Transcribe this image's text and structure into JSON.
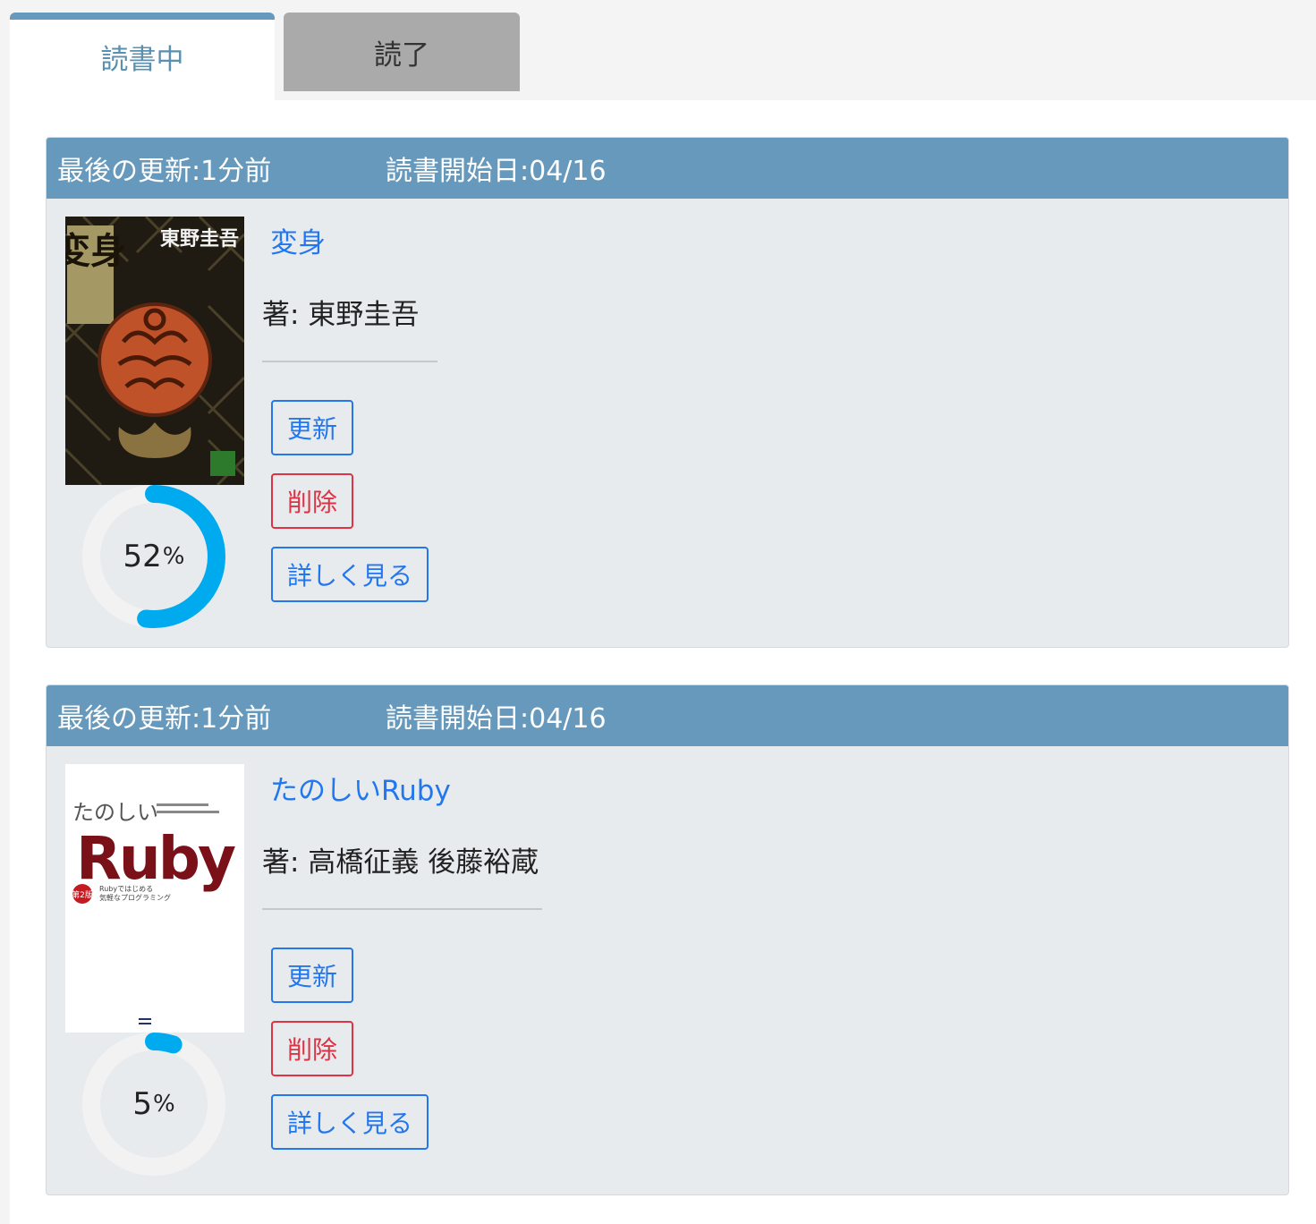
{
  "tabs": {
    "reading_label": "読書中",
    "finished_label": "読了"
  },
  "books": [
    {
      "updated": "最後の更新:1分前",
      "started": "読書開始日:04/16",
      "title": "変身",
      "author": "著: 東野圭吾",
      "progress": 52,
      "progress_label": "52",
      "percent_sign": "%",
      "cover_text": {
        "title": "変身",
        "author": "東野圭吾"
      },
      "buttons": {
        "update": "更新",
        "delete": "削除",
        "details": "詳しく見る"
      }
    },
    {
      "updated": "最後の更新:1分前",
      "started": "読書開始日:04/16",
      "title": "たのしいRuby",
      "author": "著: 高橋征義 後藤裕蔵",
      "progress": 5,
      "progress_label": "5",
      "percent_sign": "%",
      "cover_text": {
        "subtitle": "たのしい",
        "title": "Ruby",
        "edition": "第2版",
        "tagline1": "Rubyではじめる",
        "tagline2": "気軽なプログラミング"
      },
      "buttons": {
        "update": "更新",
        "delete": "削除",
        "details": "詳しく見る"
      }
    }
  ],
  "colors": {
    "header": "#6699bb",
    "progress": "#00aaee",
    "ring_track": "#f2f2f2",
    "link": "#2277ee",
    "danger": "#dd3344"
  }
}
